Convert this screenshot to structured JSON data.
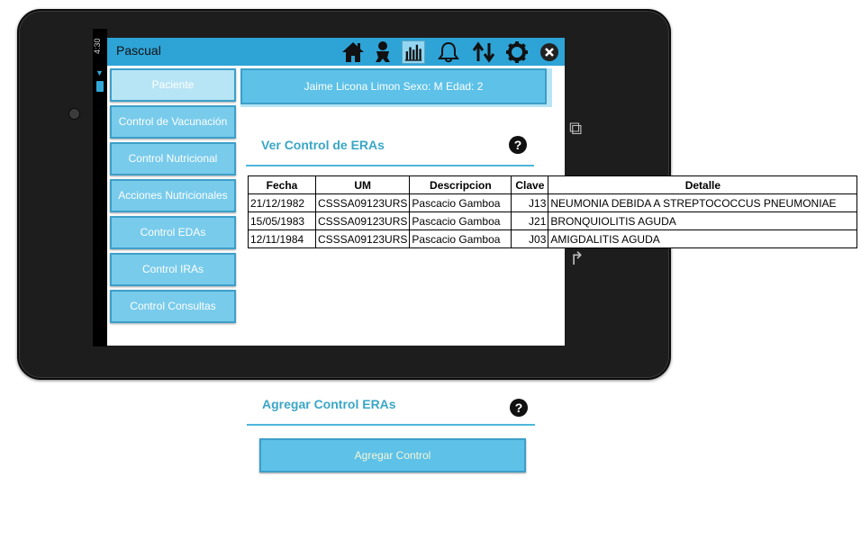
{
  "status_bar": {
    "time": "4:30"
  },
  "app_bar": {
    "title": "Pascual",
    "icons": [
      "home-icon",
      "baby-icon",
      "bar-chart-icon",
      "bell-icon",
      "sync-arrows-icon",
      "gear-icon",
      "close-icon"
    ]
  },
  "sidebar": {
    "items": [
      {
        "label": "Paciente"
      },
      {
        "label": "Control de Vacunación"
      },
      {
        "label": "Control Nutricional"
      },
      {
        "label": "Acciones Nutricionales"
      },
      {
        "label": "Control EDAs"
      },
      {
        "label": "Control IRAs"
      },
      {
        "label": "Control Consultas"
      }
    ]
  },
  "patient_banner": "Jaime Licona Limon Sexo: M Edad: 2",
  "view_section": {
    "title": "Ver Control de ERAs",
    "help": "?"
  },
  "table": {
    "headers": [
      "Fecha",
      "UM",
      "Descripcion",
      "Clave",
      "Detalle"
    ],
    "rows": [
      [
        "21/12/1982",
        "CSSSA09123URS",
        "Pascacio Gamboa",
        "J13",
        "NEUMONIA DEBIDA A STREPTOCOCCUS PNEUMONIAE"
      ],
      [
        "15/05/1983",
        "CSSSA09123URS",
        "Pascacio Gamboa",
        "J21",
        "BRONQUIOLITIS AGUDA"
      ],
      [
        "12/11/1984",
        "CSSSA09123URS",
        "Pascacio Gamboa",
        "J03",
        "AMIGDALITIS AGUDA"
      ]
    ]
  },
  "add_section": {
    "title": "Agregar Control ERAs",
    "help": "?",
    "button_label": "Agregar Control"
  },
  "colors": {
    "app_bar": "#2ea3d6",
    "button": "#5dc1e8",
    "button_border": "#3d9fc9",
    "accent_text": "#3aa6c7"
  }
}
